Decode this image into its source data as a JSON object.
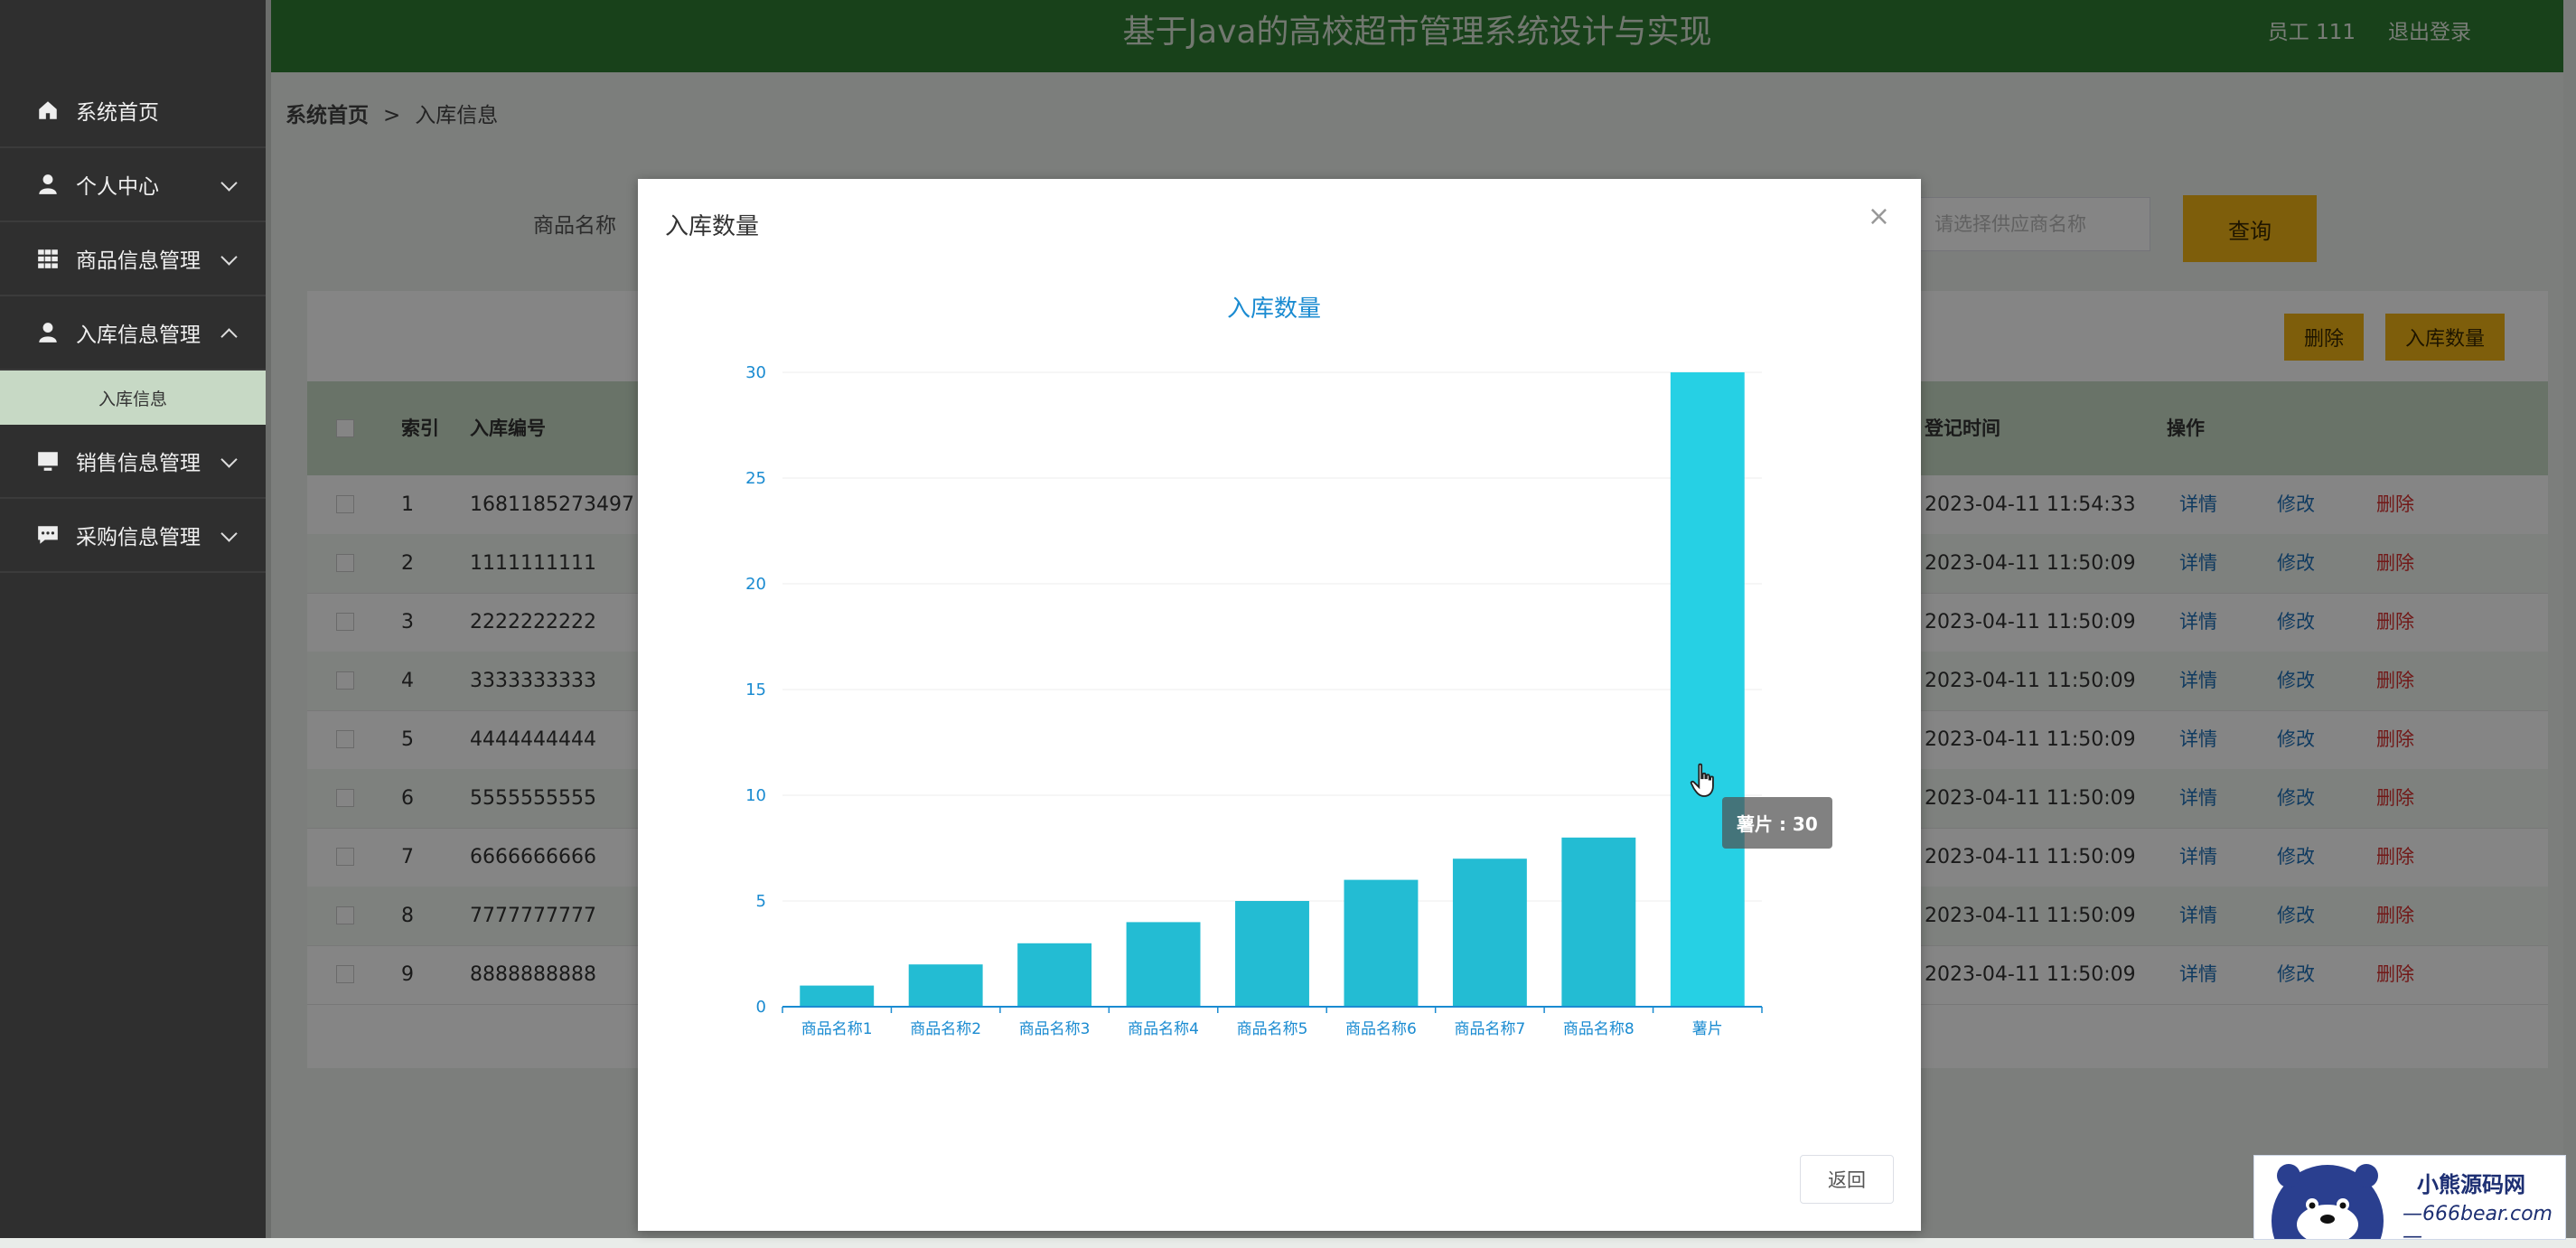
{
  "header": {
    "title": "基于Java的高校超市管理系统设计与实现",
    "user": "员工 111",
    "logout": "退出登录"
  },
  "sidebar": {
    "items": [
      {
        "label": "系统首页",
        "icon": "home-icon"
      },
      {
        "label": "个人中心",
        "icon": "user-icon"
      },
      {
        "label": "商品信息管理",
        "icon": "grid-icon"
      },
      {
        "label": "入库信息管理",
        "icon": "user-icon"
      },
      {
        "label": "销售信息管理",
        "icon": "monitor-icon"
      },
      {
        "label": "采购信息管理",
        "icon": "chat-icon"
      }
    ],
    "sub_item": "入库信息"
  },
  "breadcrumb": {
    "home": "系统首页",
    "sep": ">",
    "current": "入库信息"
  },
  "search": {
    "label": "商品名称",
    "supplier_placeholder": "请选择供应商名称",
    "query_button": "查询"
  },
  "toolbar": {
    "delete": "删除",
    "stock_count": "入库数量"
  },
  "table": {
    "headers": {
      "index": "索引",
      "code": "入库编号",
      "time": "登记时间",
      "ops": "操作"
    },
    "rows": [
      {
        "index": "1",
        "code": "1681185273497",
        "time": "2023-04-11 11:54:33"
      },
      {
        "index": "2",
        "code": "1111111111",
        "time": "2023-04-11 11:50:09"
      },
      {
        "index": "3",
        "code": "2222222222",
        "time": "2023-04-11 11:50:09"
      },
      {
        "index": "4",
        "code": "3333333333",
        "time": "2023-04-11 11:50:09"
      },
      {
        "index": "5",
        "code": "4444444444",
        "time": "2023-04-11 11:50:09"
      },
      {
        "index": "6",
        "code": "5555555555",
        "time": "2023-04-11 11:50:09"
      },
      {
        "index": "7",
        "code": "6666666666",
        "time": "2023-04-11 11:50:09"
      },
      {
        "index": "8",
        "code": "7777777777",
        "time": "2023-04-11 11:50:09"
      },
      {
        "index": "9",
        "code": "8888888888",
        "time": "2023-04-11 11:50:09"
      }
    ],
    "actions": {
      "detail": "详情",
      "edit": "修改",
      "delete": "删除"
    }
  },
  "dialog": {
    "title": "入库数量",
    "close": "×",
    "return_button": "返回"
  },
  "chart_data": {
    "type": "bar",
    "title": "入库数量",
    "categories": [
      "商品名称1",
      "商品名称2",
      "商品名称3",
      "商品名称4",
      "商品名称5",
      "商品名称6",
      "商品名称7",
      "商品名称8",
      "薯片"
    ],
    "values": [
      1,
      2,
      3,
      4,
      5,
      6,
      7,
      8,
      30
    ],
    "ylim": [
      0,
      30
    ],
    "yticks": [
      0,
      5,
      10,
      15,
      20,
      25,
      30
    ],
    "xlabel": "",
    "ylabel": "",
    "grid": true,
    "colors": {
      "bar": "#23bcd3",
      "highlight": "#26d0e4",
      "axis": "#1a8bd1"
    },
    "tooltip": "薯片 : 30"
  },
  "watermark": {
    "title": "小熊源码网",
    "url": "—666bear.com—"
  }
}
